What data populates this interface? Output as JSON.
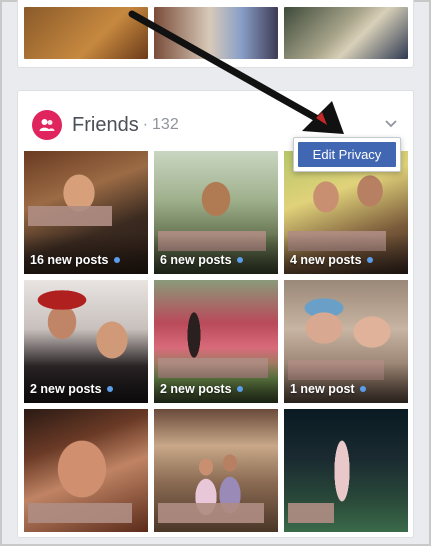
{
  "friends_section": {
    "title": "Friends",
    "separator": "·",
    "count": "132",
    "menu_item": "Edit Privacy"
  },
  "tiles": [
    {
      "caption": "16 new posts"
    },
    {
      "caption": "6 new posts"
    },
    {
      "caption": "4 new posts"
    },
    {
      "caption": "2 new posts"
    },
    {
      "caption": "2 new posts"
    },
    {
      "caption": "1 new post"
    },
    {
      "caption": ""
    },
    {
      "caption": ""
    },
    {
      "caption": ""
    }
  ],
  "colors": {
    "page_bg": "#e9ebee",
    "friends_badge": "#e0245e",
    "menu_highlight": "#4267b2",
    "new_dot": "#5b9dea",
    "arrow": "#111111"
  },
  "icons": {
    "friends_badge": "people-icon",
    "section_menu": "chevron-down-icon",
    "annotation": "arrow-icon"
  }
}
